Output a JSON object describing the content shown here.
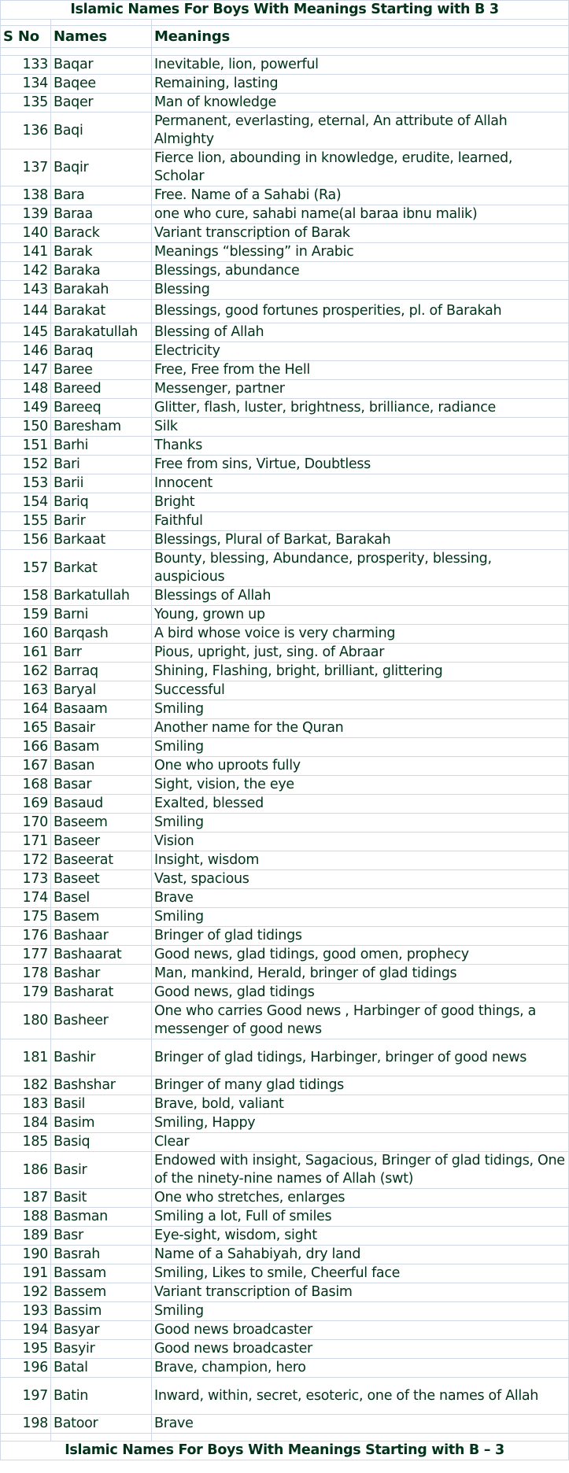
{
  "title_top": "Islamic Names For Boys With Meanings Starting with B 3",
  "title_bottom": "Islamic Names For Boys With Meanings Starting with B – 3",
  "headers": {
    "sno": "S No",
    "name": "Names",
    "meaning": "Meanings"
  },
  "colors": {
    "text": "#00331a",
    "border": "#d0d7e5",
    "background": "#ffffff"
  },
  "rows": [
    {
      "sno": "133",
      "name": "Baqar",
      "meaning": "Inevitable, lion, powerful"
    },
    {
      "sno": "134",
      "name": "Baqee",
      "meaning": "Remaining, lasting"
    },
    {
      "sno": "135",
      "name": "Baqer",
      "meaning": "Man of knowledge"
    },
    {
      "sno": "136",
      "name": "Baqi",
      "meaning": "Permanent, everlasting, eternal, An attribute of Allah Almighty"
    },
    {
      "sno": "137",
      "name": "Baqir",
      "meaning": "Fierce lion, abounding in knowledge, erudite, learned, Scholar"
    },
    {
      "sno": "138",
      "name": "Bara",
      "meaning": "Free. Name of a Sahabi (Ra)"
    },
    {
      "sno": "139",
      "name": "Baraa",
      "meaning": "one who cure, sahabi name(al baraa ibnu malik)"
    },
    {
      "sno": "140",
      "name": "Barack",
      "meaning": "Variant transcription of Barak"
    },
    {
      "sno": "141",
      "name": "Barak",
      "meaning": "Meanings “blessing” in Arabic"
    },
    {
      "sno": "142",
      "name": "Baraka",
      "meaning": "Blessings, abundance"
    },
    {
      "sno": "143",
      "name": "Barakah",
      "meaning": "Blessing"
    },
    {
      "sno": "144",
      "name": "Barakat",
      "meaning": "Blessings, good fortunes prosperities, pl. of Barakah"
    },
    {
      "sno": "145",
      "name": "Barakatullah",
      "meaning": "Blessing of Allah"
    },
    {
      "sno": "146",
      "name": "Baraq",
      "meaning": "Electricity"
    },
    {
      "sno": "147",
      "name": "Baree",
      "meaning": "Free, Free from the Hell"
    },
    {
      "sno": "148",
      "name": "Bareed",
      "meaning": "Messenger, partner"
    },
    {
      "sno": "149",
      "name": "Bareeq",
      "meaning": "Glitter, flash, luster, brightness, brilliance, radiance"
    },
    {
      "sno": "150",
      "name": "Baresham",
      "meaning": "Silk"
    },
    {
      "sno": "151",
      "name": "Barhi",
      "meaning": "Thanks"
    },
    {
      "sno": "152",
      "name": "Bari",
      "meaning": "Free from sins, Virtue, Doubtless"
    },
    {
      "sno": "153",
      "name": "Barii",
      "meaning": "Innocent"
    },
    {
      "sno": "154",
      "name": "Bariq",
      "meaning": "Bright"
    },
    {
      "sno": "155",
      "name": "Barir",
      "meaning": "Faithful"
    },
    {
      "sno": "156",
      "name": "Barkaat",
      "meaning": "Blessings, Plural of Barkat, Barakah"
    },
    {
      "sno": "157",
      "name": "Barkat",
      "meaning": "Bounty, blessing, Abundance, prosperity, blessing, auspicious"
    },
    {
      "sno": "158",
      "name": "Barkatullah",
      "meaning": "Blessings of Allah"
    },
    {
      "sno": "159",
      "name": "Barni",
      "meaning": "Young, grown up"
    },
    {
      "sno": "160",
      "name": "Barqash",
      "meaning": "A bird whose voice is very charming"
    },
    {
      "sno": "161",
      "name": "Barr",
      "meaning": "Pious, upright, just, sing. of Abraar"
    },
    {
      "sno": "162",
      "name": "Barraq",
      "meaning": "Shining, Flashing, bright, brilliant, glittering"
    },
    {
      "sno": "163",
      "name": "Baryal",
      "meaning": "Successful"
    },
    {
      "sno": "164",
      "name": "Basaam",
      "meaning": "Smiling"
    },
    {
      "sno": "165",
      "name": "Basair",
      "meaning": "Another name for the Quran"
    },
    {
      "sno": "166",
      "name": "Basam",
      "meaning": "Smiling"
    },
    {
      "sno": "167",
      "name": "Basan",
      "meaning": "One who uproots fully"
    },
    {
      "sno": "168",
      "name": "Basar",
      "meaning": "Sight, vision, the eye"
    },
    {
      "sno": "169",
      "name": "Basaud",
      "meaning": "Exalted, blessed"
    },
    {
      "sno": "170",
      "name": "Baseem",
      "meaning": "Smiling"
    },
    {
      "sno": "171",
      "name": "Baseer",
      "meaning": "Vision"
    },
    {
      "sno": "172",
      "name": "Baseerat",
      "meaning": "Insight, wisdom"
    },
    {
      "sno": "173",
      "name": "Baseet",
      "meaning": "Vast, spacious"
    },
    {
      "sno": "174",
      "name": "Basel",
      "meaning": "Brave"
    },
    {
      "sno": "175",
      "name": "Basem",
      "meaning": "Smiling"
    },
    {
      "sno": "176",
      "name": "Bashaar",
      "meaning": "Bringer of glad tidings"
    },
    {
      "sno": "177",
      "name": "Bashaarat",
      "meaning": "Good news, glad tidings, good omen, prophecy"
    },
    {
      "sno": "178",
      "name": "Bashar",
      "meaning": "Man, mankind, Herald, bringer of glad tidings"
    },
    {
      "sno": "179",
      "name": "Basharat",
      "meaning": "Good news, glad tidings"
    },
    {
      "sno": "180",
      "name": "Basheer",
      "meaning": "One who carries Good news , Harbinger of good things, a messenger of good news"
    },
    {
      "sno": "181",
      "name": "Bashir",
      "meaning": "Bringer of glad tidings, Harbinger, bringer of good news"
    },
    {
      "sno": "182",
      "name": "Bashshar",
      "meaning": "Bringer of many glad tidings"
    },
    {
      "sno": "183",
      "name": "Basil",
      "meaning": "Brave, bold, valiant"
    },
    {
      "sno": "184",
      "name": "Basim",
      "meaning": "Smiling, Happy"
    },
    {
      "sno": "185",
      "name": "Basiq",
      "meaning": "Clear"
    },
    {
      "sno": "186",
      "name": "Basir",
      "meaning": "Endowed with insight, Sagacious, Bringer of glad tidings, One of the ninety-nine names of Allah (swt)"
    },
    {
      "sno": "187",
      "name": "Basit",
      "meaning": "One who stretches, enlarges"
    },
    {
      "sno": "188",
      "name": "Basman",
      "meaning": "Smiling a lot, Full of smiles"
    },
    {
      "sno": "189",
      "name": "Basr",
      "meaning": "Eye-sight, wisdom, sight"
    },
    {
      "sno": "190",
      "name": "Basrah",
      "meaning": "Name of a Sahabiyah, dry land"
    },
    {
      "sno": "191",
      "name": "Bassam",
      "meaning": "Smiling, Likes to smile, Cheerful face"
    },
    {
      "sno": "192",
      "name": "Bassem",
      "meaning": "Variant transcription of Basim"
    },
    {
      "sno": "193",
      "name": "Bassim",
      "meaning": "Smiling"
    },
    {
      "sno": "194",
      "name": "Basyar",
      "meaning": "Good news broadcaster"
    },
    {
      "sno": "195",
      "name": "Basyir",
      "meaning": "Good news broadcaster"
    },
    {
      "sno": "196",
      "name": "Batal",
      "meaning": "Brave, champion, hero"
    },
    {
      "sno": "197",
      "name": "Batin",
      "meaning": "Inward, within, secret, esoteric, one of the names of Allah"
    },
    {
      "sno": "198",
      "name": "Batoor",
      "meaning": "Brave"
    }
  ]
}
